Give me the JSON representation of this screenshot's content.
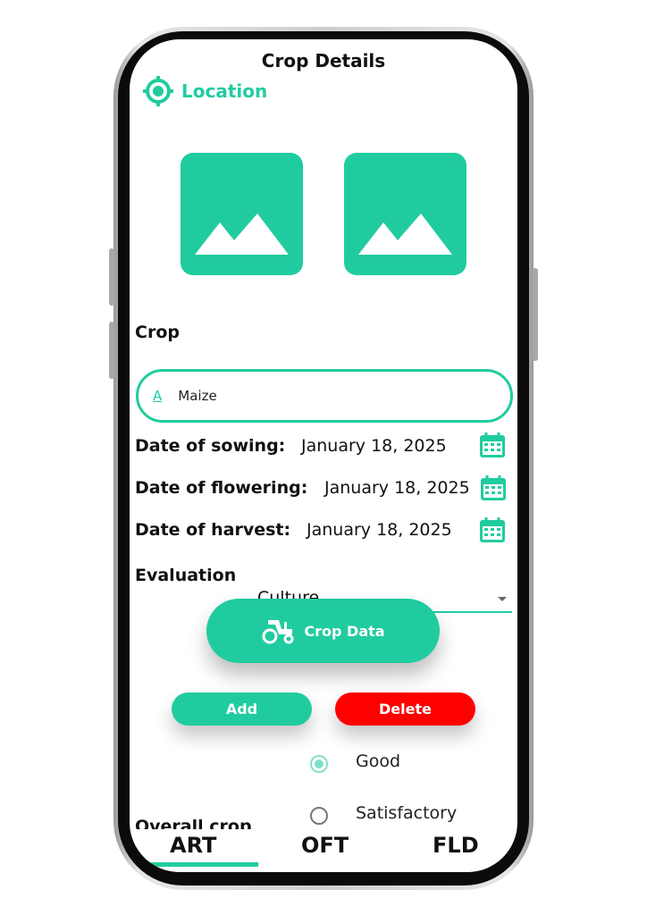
{
  "header": {
    "title": "Crop Details",
    "location_label": "Location"
  },
  "images": [
    {
      "icon": "image-placeholder-icon"
    },
    {
      "icon": "image-placeholder-icon"
    }
  ],
  "crop": {
    "label": "Crop",
    "value": "Maize"
  },
  "dates": [
    {
      "label": "Date of sowing:",
      "value": "January 18, 2025"
    },
    {
      "label": "Date of flowering:",
      "value": "January 18, 2025"
    },
    {
      "label": "Date of harvest:",
      "value": "January 18, 2025"
    }
  ],
  "evaluation": {
    "label": "Evaluation",
    "selected": "Culture"
  },
  "buttons": {
    "crop_data": "Crop Data",
    "add": "Add",
    "delete": "Delete"
  },
  "overall": {
    "label": "Overall crop",
    "options": [
      {
        "label": "Good",
        "selected": true
      },
      {
        "label": "Satisfactory",
        "selected": false
      }
    ]
  },
  "tabs": [
    {
      "label": "ART",
      "active": true
    },
    {
      "label": "OFT"
    },
    {
      "label": "FLD"
    }
  ],
  "colors": {
    "accent": "#20cc9f",
    "danger": "#ff0000"
  }
}
